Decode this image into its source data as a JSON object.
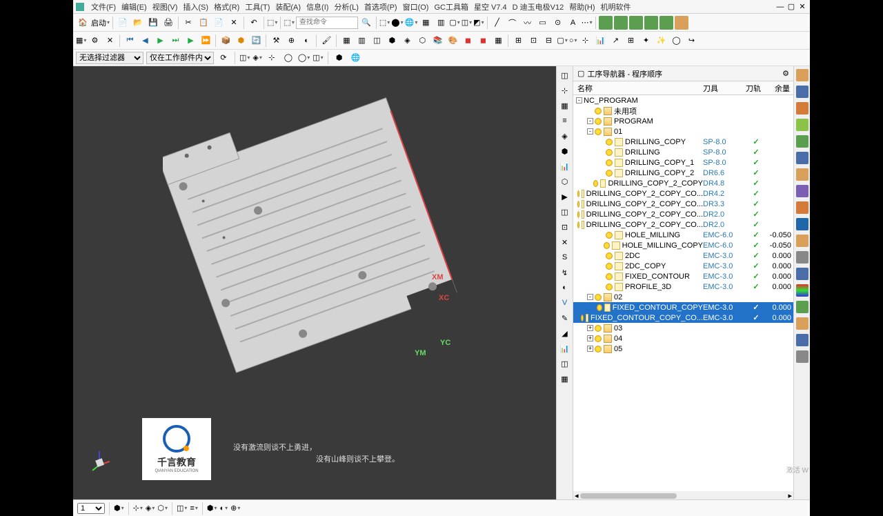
{
  "menu": {
    "items": [
      "文件(F)",
      "编辑(E)",
      "视图(V)",
      "插入(S)",
      "格式(R)",
      "工具(T)",
      "装配(A)",
      "信息(I)",
      "分析(L)",
      "首选项(P)",
      "窗口(O)",
      "GC工具箱",
      "星空 V7.4",
      "D 迪玉电极V12",
      "帮助(H)",
      "机明软件"
    ]
  },
  "toolbar1": {
    "start_label": "启动",
    "search_placeholder": "查找命令"
  },
  "filter": {
    "sel1": "无选择过滤器",
    "sel2": "仅在工作部件内"
  },
  "nav": {
    "title": "工序导航器 - 程序顺序",
    "cols": {
      "name": "名称",
      "tool": "刀具",
      "path": "刀轨",
      "extra": "余量"
    },
    "rows": [
      {
        "indent": 0,
        "exp": "-",
        "icon": "root",
        "label": "NC_PROGRAM",
        "tool": "",
        "path": "",
        "extra": ""
      },
      {
        "indent": 1,
        "exp": "",
        "icon": "folder",
        "label": "未用项",
        "tool": "",
        "path": "",
        "extra": ""
      },
      {
        "indent": 1,
        "exp": "-",
        "icon": "folder",
        "label": "PROGRAM",
        "tool": "",
        "path": "",
        "extra": ""
      },
      {
        "indent": 1,
        "exp": "-",
        "icon": "folder",
        "label": "01",
        "tool": "",
        "path": "",
        "extra": ""
      },
      {
        "indent": 2,
        "exp": "",
        "icon": "op",
        "label": "DRILLING_COPY",
        "tool": "SP-8.0",
        "path": "✓",
        "extra": ""
      },
      {
        "indent": 2,
        "exp": "",
        "icon": "op",
        "label": "DRILLING",
        "tool": "SP-8.0",
        "path": "✓",
        "extra": ""
      },
      {
        "indent": 2,
        "exp": "",
        "icon": "op",
        "label": "DRILLING_COPY_1",
        "tool": "SP-8.0",
        "path": "✓",
        "extra": ""
      },
      {
        "indent": 2,
        "exp": "",
        "icon": "op",
        "label": "DRILLING_COPY_2",
        "tool": "DR6.6",
        "path": "✓",
        "extra": ""
      },
      {
        "indent": 2,
        "exp": "",
        "icon": "op",
        "label": "DRILLING_COPY_2_COPY",
        "tool": "DR4.8",
        "path": "✓",
        "extra": ""
      },
      {
        "indent": 2,
        "exp": "",
        "icon": "op",
        "label": "DRILLING_COPY_2_COPY_CO...",
        "tool": "DR4.2",
        "path": "✓",
        "extra": ""
      },
      {
        "indent": 2,
        "exp": "",
        "icon": "op",
        "label": "DRILLING_COPY_2_COPY_CO...",
        "tool": "DR3.3",
        "path": "✓",
        "extra": ""
      },
      {
        "indent": 2,
        "exp": "",
        "icon": "op",
        "label": "DRILLING_COPY_2_COPY_CO...",
        "tool": "DR2.0",
        "path": "✓",
        "extra": ""
      },
      {
        "indent": 2,
        "exp": "",
        "icon": "op",
        "label": "DRILLING_COPY_2_COPY_CO...",
        "tool": "DR2.0",
        "path": "✓",
        "extra": ""
      },
      {
        "indent": 2,
        "exp": "",
        "icon": "op",
        "label": "HOLE_MILLING",
        "tool": "EMC-6.0",
        "path": "✓",
        "extra": "-0.050"
      },
      {
        "indent": 2,
        "exp": "",
        "icon": "op",
        "label": "HOLE_MILLING_COPY",
        "tool": "EMC-6.0",
        "path": "✓",
        "extra": "-0.050"
      },
      {
        "indent": 2,
        "exp": "",
        "icon": "op",
        "label": "2DC",
        "tool": "EMC-3.0",
        "path": "✓",
        "extra": "0.000"
      },
      {
        "indent": 2,
        "exp": "",
        "icon": "op",
        "label": "2DC_COPY",
        "tool": "EMC-3.0",
        "path": "✓",
        "extra": "0.000"
      },
      {
        "indent": 2,
        "exp": "",
        "icon": "op",
        "label": "FIXED_CONTOUR",
        "tool": "EMC-3.0",
        "path": "✓",
        "extra": "0.000"
      },
      {
        "indent": 2,
        "exp": "",
        "icon": "op",
        "label": "PROFILE_3D",
        "tool": "EMC-3.0",
        "path": "✓",
        "extra": "0.000"
      },
      {
        "indent": 1,
        "exp": "-",
        "icon": "folder",
        "label": "02",
        "tool": "",
        "path": "",
        "extra": ""
      },
      {
        "indent": 2,
        "exp": "",
        "icon": "op",
        "label": "FIXED_CONTOUR_COPY",
        "tool": "EMC-3.0",
        "path": "✓",
        "extra": "0.000",
        "selected": true
      },
      {
        "indent": 2,
        "exp": "",
        "icon": "op",
        "label": "FIXED_CONTOUR_COPY_CO...",
        "tool": "EMC-3.0",
        "path": "✓",
        "extra": "0.000",
        "selected": true
      },
      {
        "indent": 1,
        "exp": "+",
        "icon": "folder",
        "label": "03",
        "tool": "",
        "path": "",
        "extra": ""
      },
      {
        "indent": 1,
        "exp": "+",
        "icon": "folder",
        "label": "04",
        "tool": "",
        "path": "",
        "extra": ""
      },
      {
        "indent": 1,
        "exp": "+",
        "icon": "folder",
        "label": "05",
        "tool": "",
        "path": "",
        "extra": ""
      }
    ]
  },
  "subtitle": {
    "line1": "没有激流则谈不上勇进，",
    "line2": "没有山峰则谈不上攀登。"
  },
  "logo": {
    "name": "千言教育",
    "sub": "QIANYAN EDUCATION"
  },
  "watermark": "激活 W",
  "bottom": {
    "page": "1"
  },
  "axis": {
    "xm": "XM",
    "xc": "XC",
    "yc": "YC",
    "ym": "YM"
  }
}
